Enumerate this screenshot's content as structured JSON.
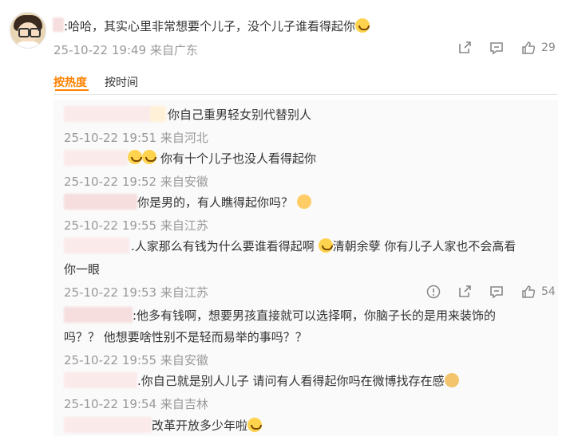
{
  "main_comment": {
    "text": ":哈哈，其实心里非常想要个儿子，没个儿子谁看得起你",
    "time": "25-10-22 19:49 来自广东",
    "likes": "29"
  },
  "sort_tabs": {
    "active": "按热度",
    "other": "按时间"
  },
  "replies": [
    {
      "text": "你自己重男轻女别代替别人",
      "meta": "25-10-22 19:51 来自河北"
    },
    {
      "text": "你有十个儿子也没人看得起你",
      "meta": "25-10-22 19:52 来自安徽"
    },
    {
      "text": "你是男的，有人瞧得起你吗？",
      "meta": "25-10-22 19:55 来自江苏"
    },
    {
      "text_line1": ".人家那么有钱为什么要谁看得起啊",
      "text_mid": "清朝余孽 你有儿子人家也不会高看",
      "text_line2": "你一眼",
      "meta": "25-10-22 19:53 来自江苏",
      "likes": "54"
    },
    {
      "text_line1": ":他多有钱啊，想要男孩直接就可以选择啊，你脑子长的是用来装饰的",
      "text_line2": "吗？？ 他想要啥性别不是轻而易举的事吗？？",
      "meta": "25-10-22 19:55 来自安徽"
    },
    {
      "text": ".你自己就是别人儿子 请问有人看得起你吗在微博找存在感",
      "meta": "25-10-22 19:54 来自吉林"
    },
    {
      "text": "改革开放多少年啦"
    }
  ],
  "colors": {
    "accent": "#ff8200",
    "meta_gray": "#999999",
    "text": "#333333"
  },
  "icons": [
    "share-icon",
    "comment-icon",
    "like-icon",
    "report-icon",
    "crying-laugh-emoji",
    "cat-emoji",
    "doge-emoji"
  ]
}
